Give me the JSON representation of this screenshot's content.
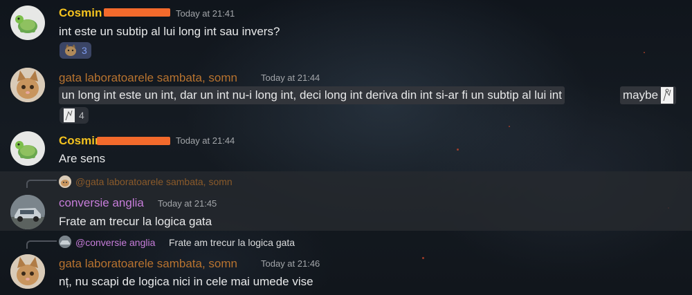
{
  "colors": {
    "cosmin": "#f5c31f",
    "gata": "#b8732f",
    "conversie": "#c77dda",
    "timestamp": "#a3a6aa",
    "redaction": "#f36a2c"
  },
  "messages": [
    {
      "author": "Cosmin",
      "timestamp": "Today at 21:41",
      "text": "int este un subtip al lui long int sau invers?",
      "avatar_icon": "turtle-icon",
      "reaction": {
        "emoji": "cat-face-emoji",
        "count": "3"
      }
    },
    {
      "author": "gata laboratoarele sambata, somn",
      "timestamp": "Today at 21:44",
      "text": "un long int este un int, dar un int nu-i long int, deci long int deriva din int si-ar fi un subtip al lui int",
      "extra": "maybe",
      "avatar_icon": "kitten-icon",
      "reaction": {
        "emoji": "sketch-emoji",
        "count": "4"
      }
    },
    {
      "author": "Cosmin",
      "timestamp": "Today at 21:44",
      "text": "Are sens",
      "avatar_icon": "turtle-icon"
    },
    {
      "reply_to": "@gata laboratoarele sambata, somn",
      "author": "conversie anglia",
      "timestamp": "Today at 21:45",
      "text": "Frate am trecur la logica gata",
      "avatar_icon": "car-icon"
    },
    {
      "reply_to": "@conversie anglia",
      "reply_text": "Frate am trecur la logica gata",
      "author": "gata laboratoarele sambata, somn",
      "timestamp": "Today at 21:46",
      "text": "nț, nu scapi de logica nici in cele mai umede vise",
      "avatar_icon": "kitten-icon"
    }
  ]
}
